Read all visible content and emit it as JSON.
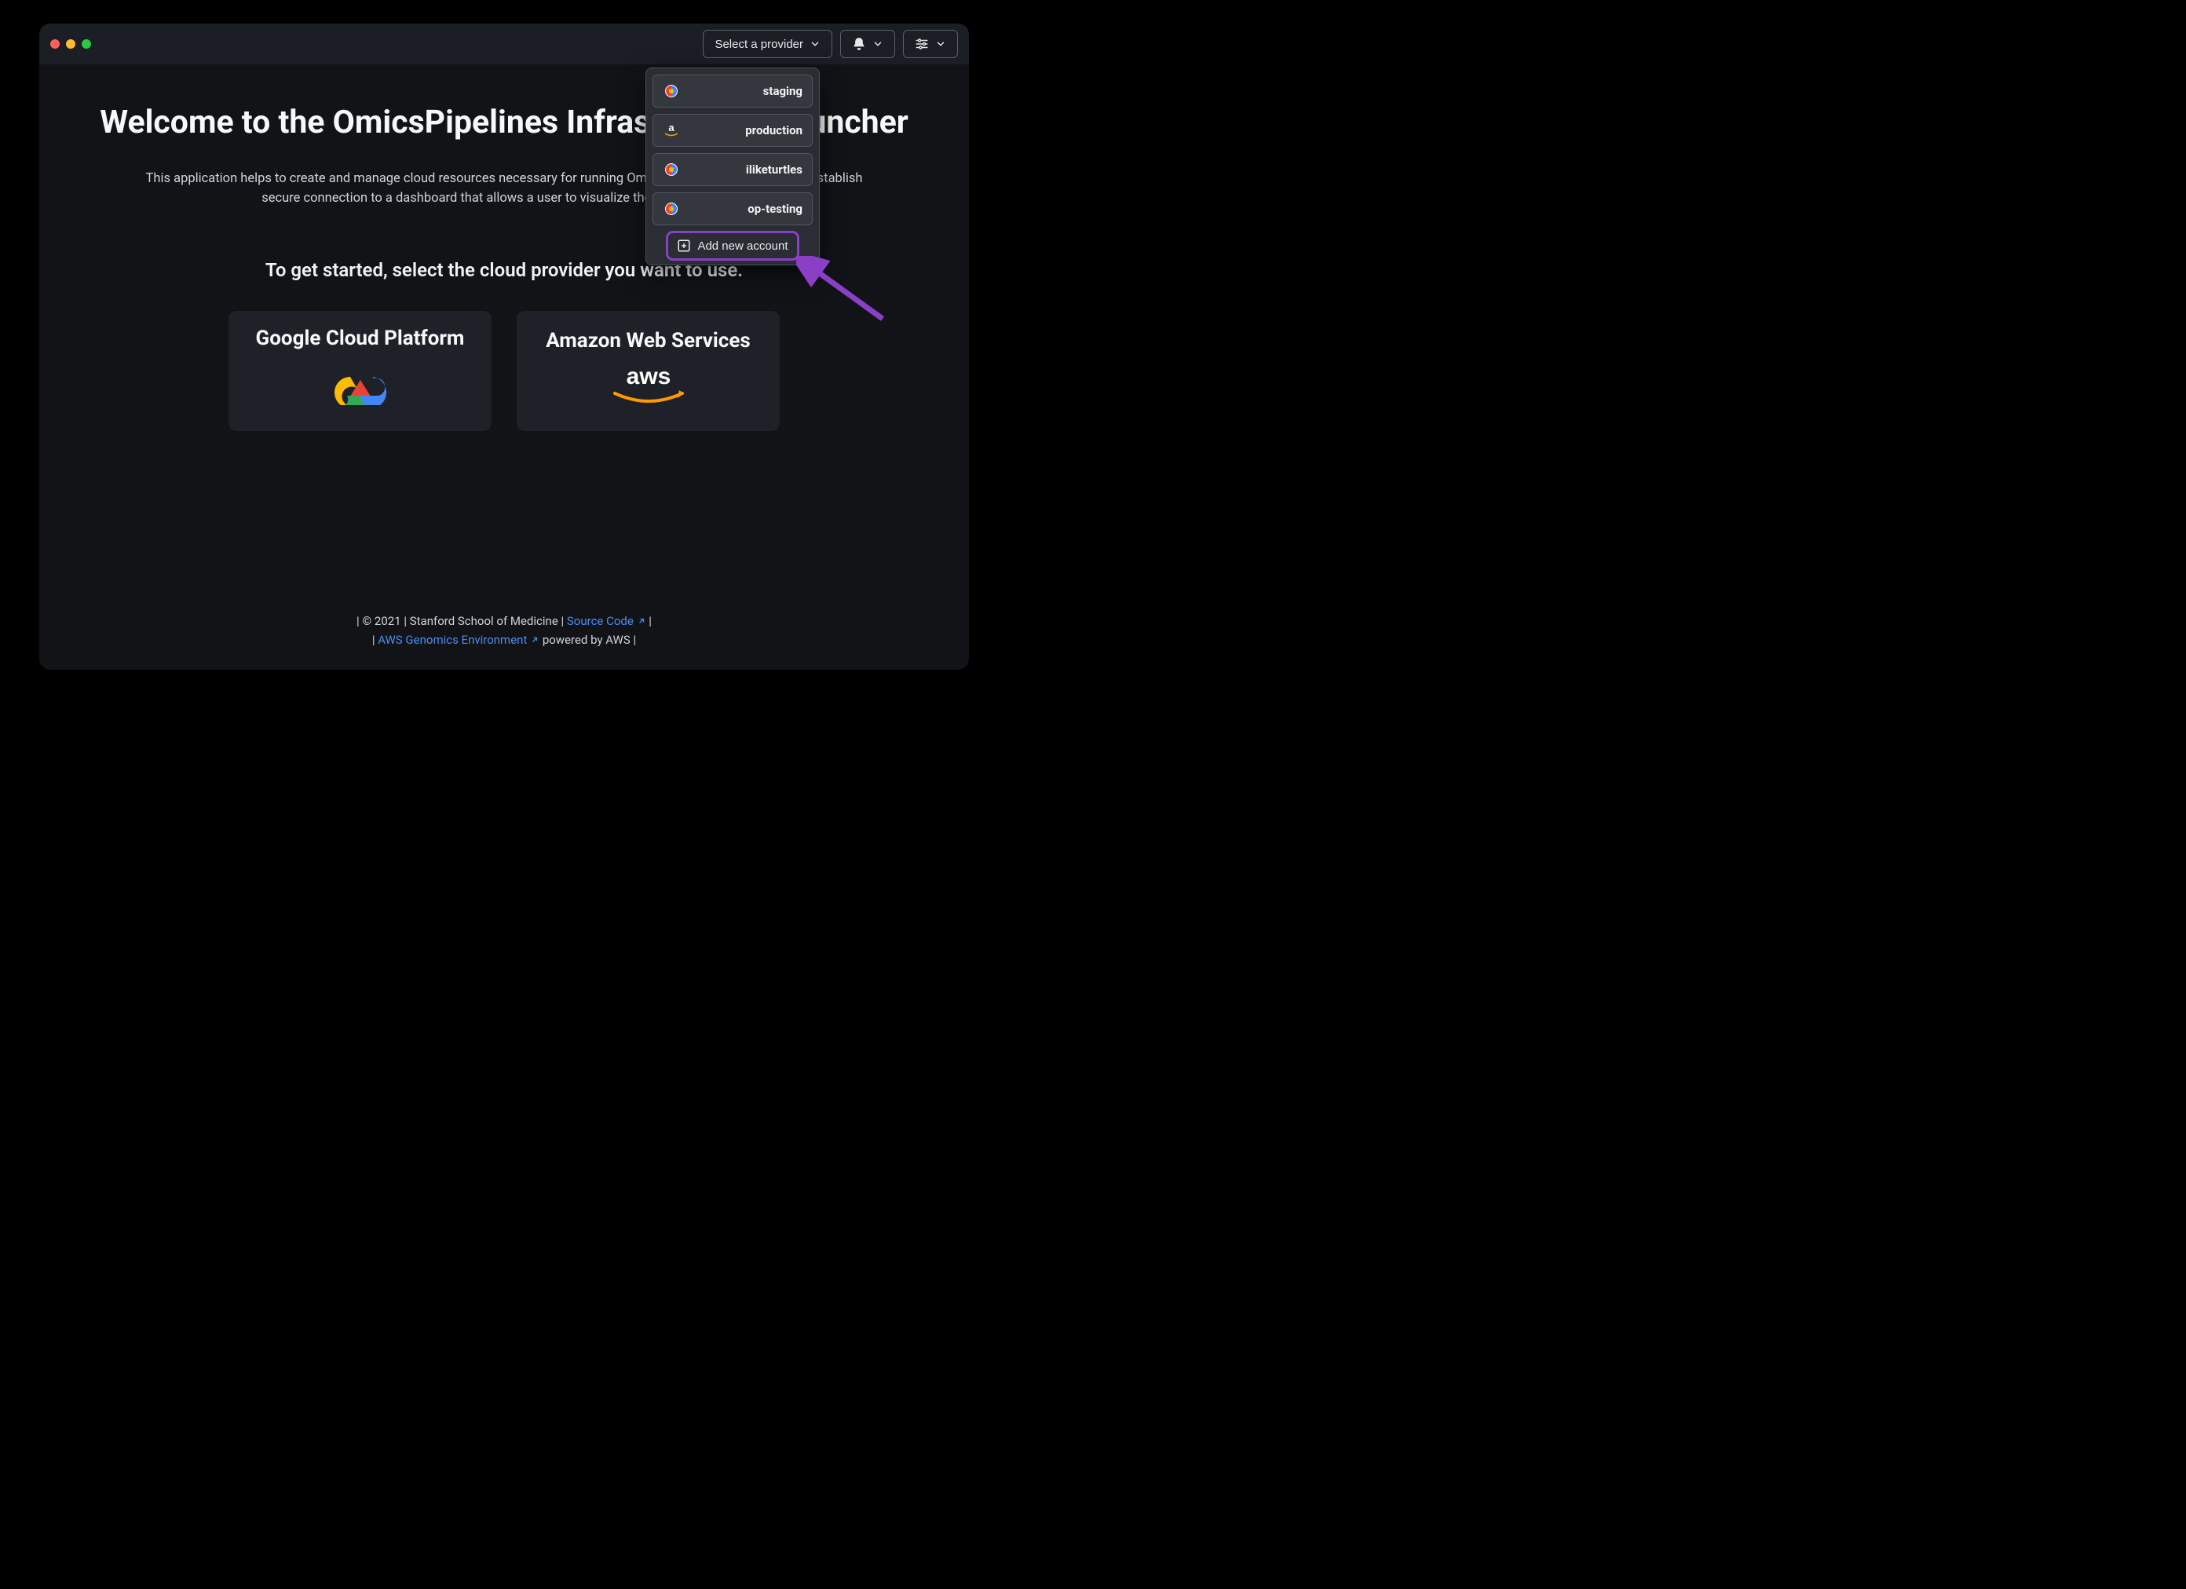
{
  "toolbar": {
    "provider_select_label": "Select a provider"
  },
  "main": {
    "heading": "Welcome to the OmicsPipelines Infrastructure Launcher",
    "subtitle": "This application helps to create and manage cloud resources necessary for running OmicsPipelines. It also helps to establish secure connection to a dashboard that allows a user to visualize their workflow runs.",
    "prompt": "To get started, select the cloud provider you want to use.",
    "cards": {
      "gcp": "Google Cloud Platform",
      "aws": "Amazon Web Services"
    }
  },
  "dropdown": {
    "accounts": [
      {
        "label": "staging",
        "provider": "gcp"
      },
      {
        "label": "production",
        "provider": "aws"
      },
      {
        "label": "iliketurtles",
        "provider": "gcp"
      },
      {
        "label": "op-testing",
        "provider": "gcp"
      }
    ],
    "add_label": "Add new account"
  },
  "footer": {
    "copyright": "| © 2021 | Stanford School of Medicine | ",
    "source_code": "Source Code",
    "source_trail": " |",
    "aws_lead": "| ",
    "aws_env": "AWS Genomics Environment",
    "aws_trail": " powered by AWS |"
  }
}
